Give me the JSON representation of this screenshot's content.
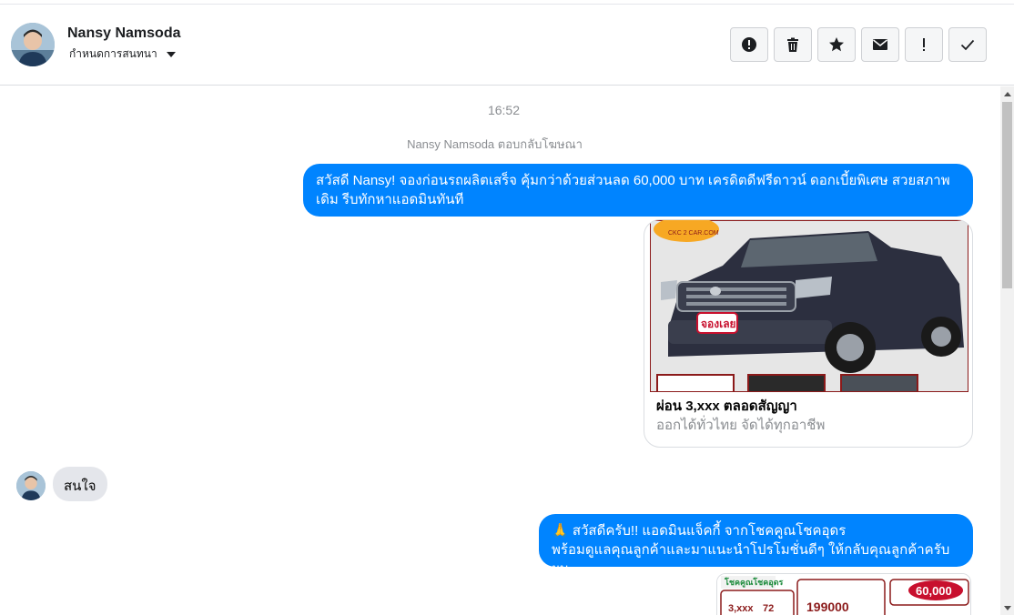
{
  "header": {
    "contact_name": "Nansy Namsoda",
    "assign_label": "กำหนดการสนทนา",
    "toolbar": [
      {
        "name": "spam-button",
        "icon": "exclamation-circle-icon"
      },
      {
        "name": "delete-button",
        "icon": "trash-icon"
      },
      {
        "name": "star-button",
        "icon": "star-icon"
      },
      {
        "name": "mark-unread-button",
        "icon": "envelope-icon"
      },
      {
        "name": "follow-up-button",
        "icon": "exclamation-icon"
      },
      {
        "name": "mark-done-button",
        "icon": "checkmark-icon"
      }
    ]
  },
  "thread": {
    "timestamp": "16:52",
    "replied_note": "Nansy Namsoda ตอบกลับโฆษณา",
    "message_1": "สวัสดี Nansy! จองก่อนรถผลิตเสร็จ คุ้มกว่าด้วยส่วนลด 60,000 บาท เครดิตดีฟรีดาวน์ ดอกเบี้ยพิเศษ สวยสภาพเดิม รีบทักหาแอดมินทันที",
    "ad_card": {
      "title": "ผ่อน 3,xxx ตลอดสัญญา",
      "subtitle": "ออกได้ทั่วไทย จัดได้ทุกอาชีพ",
      "badge": "จองเลย",
      "logo": "CKC 2 CAR.COM"
    },
    "incoming_message": "สนใจ",
    "message_2_line1": "🙏 สวัสดีครับ!! แอดมินแจ็คกี้ จากโชคคูณโชคอุดร",
    "message_2_line2": "พร้อมดูแลคุณลูกค้าและมาแนะนำโปรโมชั่นดีๆ ให้กลับคุณลูกค้าครับผม",
    "promo": {
      "brand": "โชคคูณโชคอุดร",
      "discount": "60,000",
      "installment": "3,xxx",
      "months": "72",
      "price": "199000"
    }
  },
  "colors": {
    "outgoing_bubble": "#0084ff",
    "incoming_bubble": "#e4e6eb"
  }
}
